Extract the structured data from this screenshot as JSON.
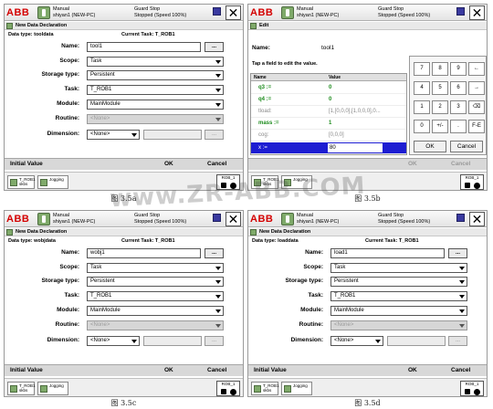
{
  "captions": {
    "a": "图 3.5a",
    "b": "图 3.5b",
    "c": "图 3.5c",
    "d": "图 3.5d"
  },
  "watermark": "www.ZR-ABB.COM",
  "top_bar": {
    "logo": "ABB",
    "mode": "Manual",
    "controller": "shiyan1 (NEW-PC)",
    "state": "Guard Stop",
    "speed": "Stopped (Speed 100%)",
    "close": "✕"
  },
  "taskbar": {
    "task1": "T_ROB1",
    "task1_sub": "skbs",
    "task2": "Jogging",
    "rob": "ROB_1",
    "rob_sub": "1/3"
  },
  "form_labels": {
    "name": "Name:",
    "scope": "Scope:",
    "storage": "Storage type:",
    "task": "Task:",
    "module": "Module:",
    "routine": "Routine:",
    "dimension": "Dimension:"
  },
  "bottom": {
    "initial": "Initial Value",
    "ok": "OK",
    "cancel": "Cancel"
  },
  "panel_a": {
    "title": "New Data Declaration",
    "data_type": "Data type: tooldata",
    "current_task": "Current Task:  T_ROB1",
    "name_value": "tool1",
    "dots": "...",
    "scope": "Task",
    "storage": "Persistent",
    "task": "T_ROB1",
    "module": "MainModule",
    "routine": "<None>",
    "dimension": "<None>"
  },
  "panel_b": {
    "title": "Edit",
    "name_label": "Name:",
    "name_value": "tool1",
    "hint": "Tap a field to edit the value.",
    "col_name": "Name",
    "col_value": "Value",
    "rows": [
      {
        "name": "q3 :=",
        "value": "0"
      },
      {
        "name": "q4 :=",
        "value": "0"
      },
      {
        "name": "tload:",
        "value": "[1,[0,0,0],[1,0,0,0],0..."
      },
      {
        "name": "mass :=",
        "value": "1"
      },
      {
        "name": "cog:",
        "value": "[0,0,0]"
      },
      {
        "name": "x :=",
        "value": "80"
      }
    ],
    "keys": [
      "7",
      "8",
      "9",
      "←",
      "4",
      "5",
      "6",
      "→",
      "1",
      "2",
      "3",
      "⌫",
      "0",
      "+/-",
      ".",
      "F-E"
    ],
    "ok": "OK",
    "cancel": "Cancel"
  },
  "panel_c": {
    "title": "New Data Declaration",
    "data_type": "Data type: wobjdata",
    "current_task": "Current Task:  T_ROB1",
    "name_value": "wobj1",
    "dots": "...",
    "scope": "Task",
    "storage": "Persistent",
    "task": "T_ROB1",
    "module": "MainModule",
    "routine": "<None>",
    "dimension": "<None>"
  },
  "panel_d": {
    "title": "New Data Declaration",
    "data_type": "Data type: loaddata",
    "current_task": "Current Task:  T_ROB1",
    "name_value": "load1",
    "dots": "...",
    "scope": "Task",
    "storage": "Persistent",
    "task": "T_ROB1",
    "module": "MainModule",
    "routine": "<None>",
    "dimension": "<None>"
  },
  "colors": {
    "logo_red": "#d40000",
    "selection_blue": "#1d1dd2",
    "value_green": "#1a8a1a"
  }
}
